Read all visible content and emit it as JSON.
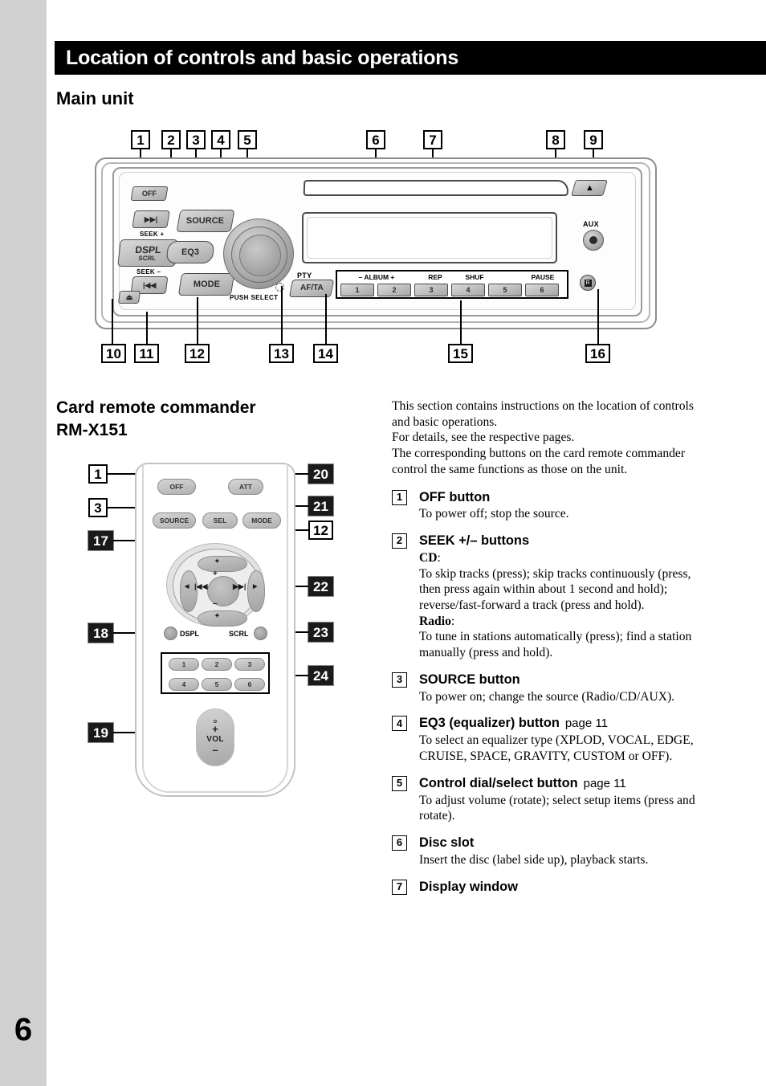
{
  "page": {
    "number": "6"
  },
  "header": {
    "title": "Location of controls and basic operations"
  },
  "sections": {
    "main_unit_title": "Main unit",
    "remote_title": "Card remote commander\nRM-X151"
  },
  "main_unit": {
    "callouts_top": [
      "1",
      "2",
      "3",
      "4",
      "5",
      "6",
      "7",
      "8",
      "9"
    ],
    "callouts_bottom": [
      "10",
      "11",
      "12",
      "13",
      "14",
      "15",
      "16"
    ],
    "buttons": {
      "off": "OFF",
      "source": "SOURCE",
      "dspl": "DSPL",
      "scrl": "SCRL",
      "eq3": "EQ3",
      "mode": "MODE",
      "afta": "AF/TA",
      "seek_plus_label": "SEEK +",
      "seek_minus_label": "SEEK –",
      "seek_plus_glyph": "▶▶|",
      "seek_minus_glyph": "|◀◀",
      "eject_glyph": "▲",
      "eject_small_glyph": "⏏",
      "push_select": "PUSH SELECT",
      "pty": "PTY",
      "aux": "AUX",
      "remote_sensor_glyph": "R"
    },
    "preset_row": {
      "headers": [
        "– ALBUM +",
        "REP",
        "SHUF",
        "PAUSE"
      ],
      "buttons": [
        "1",
        "2",
        "3",
        "4",
        "5",
        "6"
      ]
    }
  },
  "remote": {
    "callouts_left": [
      "1",
      "3",
      "17",
      "18",
      "19"
    ],
    "callouts_right": [
      "20",
      "21",
      "12",
      "22",
      "23",
      "24"
    ],
    "buttons": {
      "off": "OFF",
      "att": "ATT",
      "source": "SOURCE",
      "sel": "SEL",
      "mode": "MODE",
      "dspl": "DSPL",
      "scrl": "SCRL",
      "vol": "VOL",
      "plus": "+",
      "minus": "–",
      "prev_glyph": "|◀◀",
      "next_glyph": "▶▶|",
      "up_glyph": "✦",
      "down_glyph": "✦",
      "left_glyph": "◀",
      "right_glyph": "▶"
    },
    "presets": [
      "1",
      "2",
      "3",
      "4",
      "5",
      "6"
    ]
  },
  "text_column": {
    "intro": "This section contains instructions on the location of controls and basic operations.\nFor details, see the respective pages.\nThe corresponding buttons on the card remote commander control the same functions as those on the unit.",
    "items": [
      {
        "num": "1",
        "title": "OFF button",
        "page": "",
        "body": "To power off; stop the source."
      },
      {
        "num": "2",
        "title": "SEEK +/– buttons",
        "page": "",
        "body_html": "<b>CD</b>:\nTo skip tracks (press); skip tracks continuously (press, then press again within about 1 second and hold); reverse/fast-forward a track (press and hold).\n<b>Radio</b>:\nTo tune in stations automatically (press); find a station manually (press and hold)."
      },
      {
        "num": "3",
        "title": "SOURCE button",
        "page": "",
        "body": "To power on; change the source (Radio/CD/AUX)."
      },
      {
        "num": "4",
        "title": "EQ3 (equalizer) button",
        "page": "page 11",
        "body": "To select an equalizer type (XPLOD, VOCAL, EDGE, CRUISE, SPACE, GRAVITY, CUSTOM or OFF)."
      },
      {
        "num": "5",
        "title": "Control dial/select button",
        "page": "page 11",
        "body": "To adjust volume (rotate); select setup items (press and rotate)."
      },
      {
        "num": "6",
        "title": "Disc slot",
        "page": "",
        "body": "Insert the disc (label side up), playback starts."
      },
      {
        "num": "7",
        "title": "Display window",
        "page": "",
        "body": ""
      }
    ]
  }
}
